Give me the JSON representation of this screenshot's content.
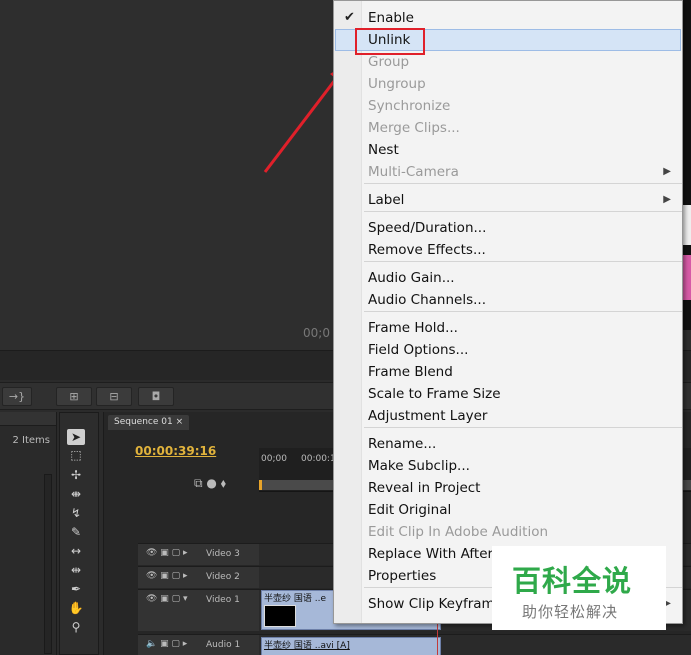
{
  "program_monitor": {
    "timecode": "00;0"
  },
  "project_panel": {
    "item_count": "2 Items"
  },
  "timeline": {
    "tab_label": "Sequence 01",
    "current_time": "00:00:39:16",
    "ruler_labels": [
      "00;00",
      "00:00:1"
    ],
    "tracks": {
      "video3": "Video 3",
      "video2": "Video 2",
      "video1": "Video 1",
      "audio1": "Audio 1"
    },
    "clips": {
      "video1_label": "半壶纱 国语 ..e",
      "audio1_label": "半壶纱 国语 ..avi [A]"
    }
  },
  "context_menu": {
    "items": [
      {
        "label": "Enable",
        "checked": true
      },
      {
        "label": "Unlink",
        "highlighted": true
      },
      {
        "label": "Group",
        "disabled": true
      },
      {
        "label": "Ungroup",
        "disabled": true
      },
      {
        "label": "Synchronize",
        "disabled": true
      },
      {
        "label": "Merge Clips...",
        "disabled": true
      },
      {
        "label": "Nest"
      },
      {
        "label": "Multi-Camera",
        "disabled": true,
        "submenu": true
      },
      {
        "label": "Label",
        "submenu": true
      },
      {
        "label": "Speed/Duration..."
      },
      {
        "label": "Remove Effects..."
      },
      {
        "label": "Audio Gain..."
      },
      {
        "label": "Audio Channels..."
      },
      {
        "label": "Frame Hold..."
      },
      {
        "label": "Field Options..."
      },
      {
        "label": "Frame Blend"
      },
      {
        "label": "Scale to Frame Size"
      },
      {
        "label": "Adjustment Layer"
      },
      {
        "label": "Rename..."
      },
      {
        "label": "Make Subclip..."
      },
      {
        "label": "Reveal in Project"
      },
      {
        "label": "Edit Original"
      },
      {
        "label": "Edit Clip In Adobe Audition",
        "disabled": true
      },
      {
        "label": "Replace With After"
      },
      {
        "label": "Properties"
      },
      {
        "label": "Show Clip Keyframe",
        "submenu": true
      }
    ]
  },
  "watermark": {
    "title": "百科全说",
    "subtitle": "助你轻松解决"
  },
  "colors": {
    "highlight": "#d5e4f6",
    "annotation_red": "#e0202a",
    "timecode": "#e1b33c",
    "clip": "#a6b8d8",
    "watermark_green": "#2fa94a"
  }
}
